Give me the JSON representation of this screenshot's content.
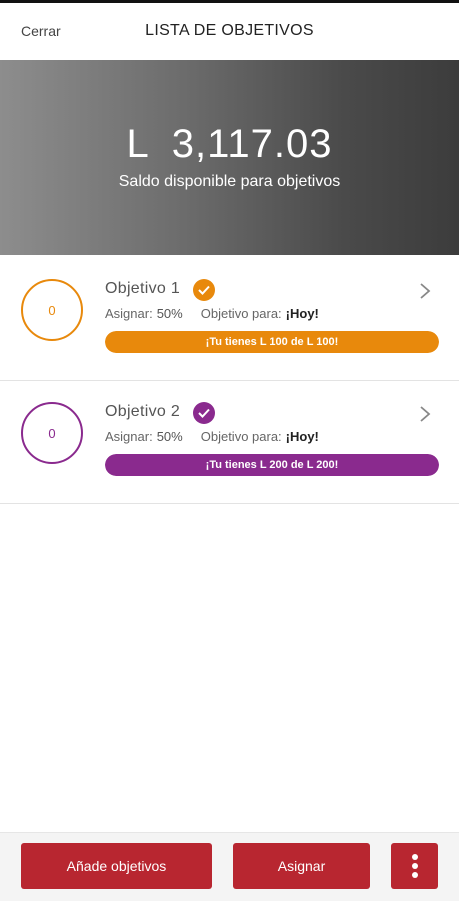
{
  "header": {
    "close_label": "Cerrar",
    "title": "LISTA DE OBJETIVOS"
  },
  "balance": {
    "currency": "L",
    "amount": "3,117.03",
    "label": "Saldo disponible para objetivos"
  },
  "goals": [
    {
      "name": "Objetivo 1",
      "ring_value": "0",
      "assign_label": "Asignar:",
      "assign_value": "50%",
      "target_label": "Objetivo para:",
      "target_value": "¡Hoy!",
      "progress_text": "¡Tu tienes L  100 de L  100!",
      "progress_fraction": 1.0,
      "color": "#e8890c",
      "check_icon": "check-circle-icon",
      "chevron_icon": "chevron-right-icon"
    },
    {
      "name": "Objetivo 2",
      "ring_value": "0",
      "assign_label": "Asignar:",
      "assign_value": "50%",
      "target_label": "Objetivo para:",
      "target_value": "¡Hoy!",
      "progress_text": "¡Tu tienes L  200 de L  200!",
      "progress_fraction": 1.0,
      "color": "#8a2a8e",
      "check_icon": "check-circle-icon",
      "chevron_icon": "chevron-right-icon"
    }
  ],
  "footer": {
    "add_label": "Añade objetivos",
    "assign_label": "Asignar",
    "more_icon": "more-vertical-icon"
  },
  "colors": {
    "accent_red": "#b82630",
    "goal1": "#e8890c",
    "goal2": "#8a2a8e"
  }
}
